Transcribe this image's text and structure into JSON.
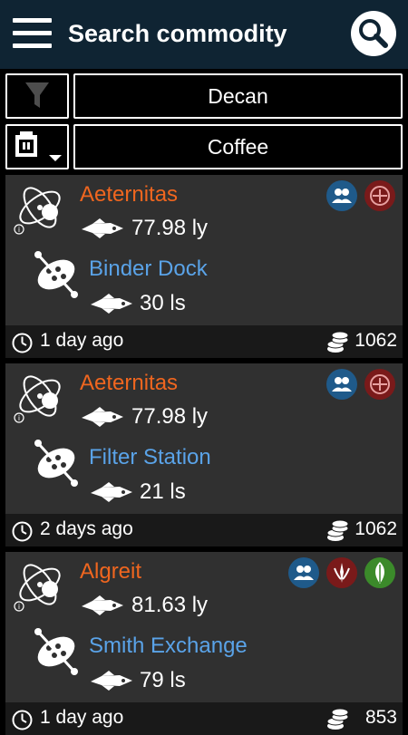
{
  "header": {
    "title": "Search commodity",
    "menu_icon": "hamburger-menu-icon",
    "search_icon": "search-icon",
    "color": "#0f2433"
  },
  "filters": {
    "system_icon": "funnel-filter-icon",
    "system_value": "Decan",
    "commodity_icon": "cargo-box-dropdown-icon",
    "commodity_value": "Coffee"
  },
  "colors": {
    "system_name": "#f0661f",
    "station_name": "#5aa3e8",
    "card_bg": "#303030",
    "footer_bg": "#191919",
    "badge_blue": "#1f5a8a",
    "badge_red": "#7a1a1a",
    "badge_green": "#3b8a2a"
  },
  "results": [
    {
      "system": "Aeternitas",
      "system_distance": "77.98 ly",
      "station": "Binder Dock",
      "station_distance": "30 ls",
      "updated": "1 day ago",
      "price": "1062",
      "badges": [
        "people-icon",
        "empire-emblem-icon"
      ]
    },
    {
      "system": "Aeternitas",
      "system_distance": "77.98 ly",
      "station": "Filter Station",
      "station_distance": "21 ls",
      "updated": "2 days ago",
      "price": "1062",
      "badges": [
        "people-icon",
        "empire-emblem-icon"
      ]
    },
    {
      "system": "Algreit",
      "system_distance": "81.63 ly",
      "station": "Smith Exchange",
      "station_distance": "79 ls",
      "updated": "1 day ago",
      "price": "853",
      "badges": [
        "people-icon",
        "federation-emblem-icon",
        "leaf-icon"
      ]
    }
  ]
}
